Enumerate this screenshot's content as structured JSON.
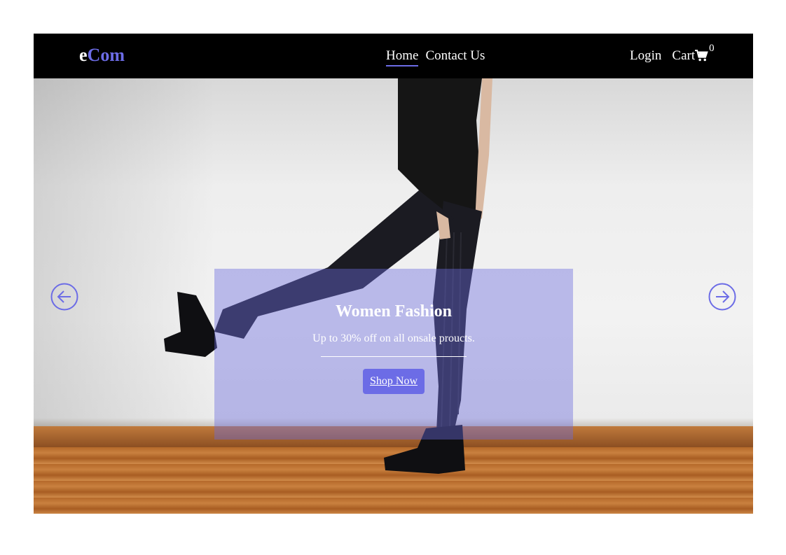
{
  "brand": {
    "prefix": "e",
    "accent": "Com",
    "accent_color": "#6c6ce6"
  },
  "nav": {
    "links": [
      {
        "label": "Home",
        "active": true
      },
      {
        "label": "Contact Us",
        "active": false
      }
    ],
    "login_label": "Login",
    "cart_label": "Cart",
    "cart_icon": "shopping-cart-icon",
    "cart_count": "0"
  },
  "slide": {
    "title": "Women Fashion",
    "subtitle": "Up to 30% off on all onsale proucts.",
    "button_label": "Shop Now",
    "prev_icon": "arrow-left-circle-icon",
    "next_icon": "arrow-right-circle-icon"
  },
  "colors": {
    "navbar_bg": "#000000",
    "accent": "#6c6ce6",
    "caption_overlay": "rgba(108,108,222,0.42)"
  }
}
